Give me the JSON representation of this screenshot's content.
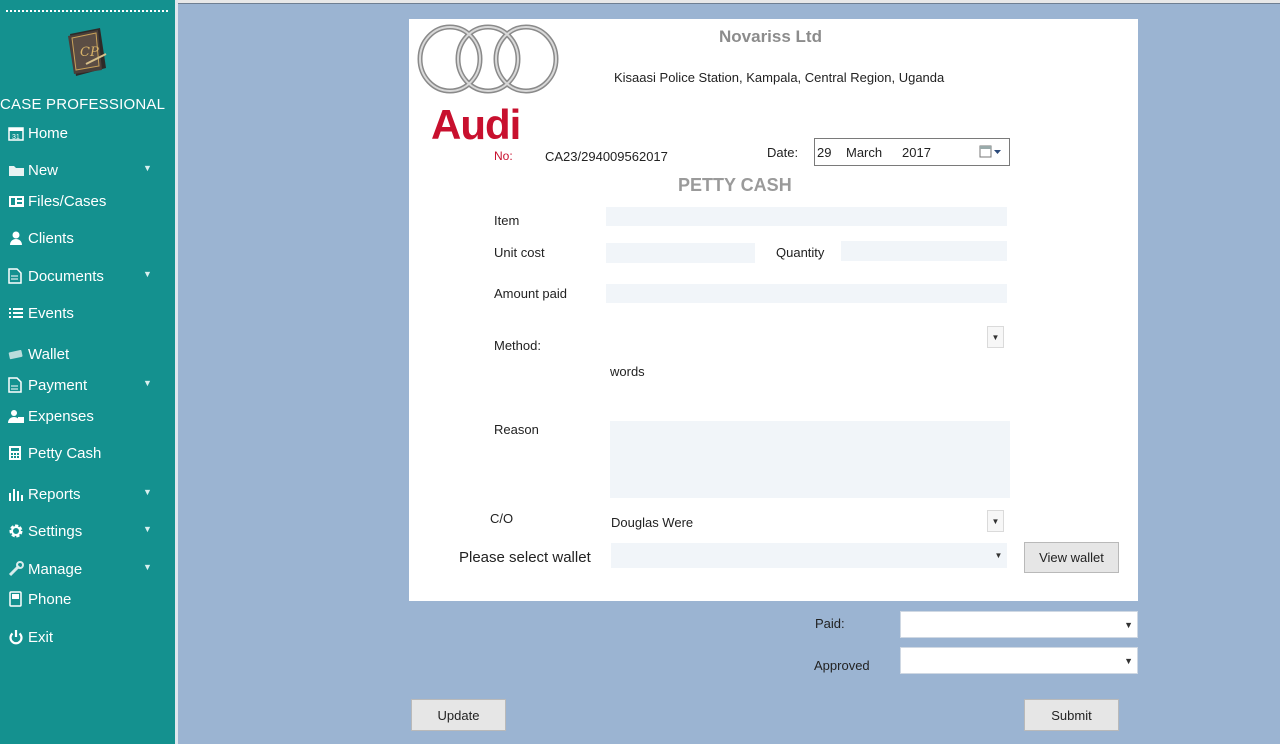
{
  "sidebar": {
    "brand": "CASE PROFESSIONAL",
    "logo_text": "CP",
    "items": [
      {
        "label": "Home",
        "icon": "calendar-icon"
      },
      {
        "label": "New",
        "icon": "folder-icon"
      },
      {
        "label": "Files/Cases",
        "icon": "files-icon"
      },
      {
        "label": "Clients",
        "icon": "clients-icon"
      },
      {
        "label": "Documents",
        "icon": "document-icon"
      },
      {
        "label": "Events",
        "icon": "list-icon"
      },
      {
        "label": "Wallet",
        "icon": "wallet-icon"
      },
      {
        "label": "Payment",
        "icon": "payment-icon"
      },
      {
        "label": "Expenses",
        "icon": "expenses-icon"
      },
      {
        "label": "Petty Cash",
        "icon": "calculator-icon"
      },
      {
        "label": "Reports",
        "icon": "bar-chart-icon"
      },
      {
        "label": "Settings",
        "icon": "gear-icon"
      },
      {
        "label": "Manage",
        "icon": "wrench-icon"
      },
      {
        "label": "Phone",
        "icon": "phone-icon"
      },
      {
        "label": "Exit",
        "icon": "power-icon"
      }
    ]
  },
  "header": {
    "company": "Novariss Ltd",
    "address": "Kisaasi  Police Station, Kampala, Central Region, Uganda",
    "logo_word": "Audi"
  },
  "form": {
    "no_label": "No:",
    "no_value": "CA23/294009562017",
    "date_label": "Date:",
    "date_day": "29",
    "date_month": "March",
    "date_year": "2017",
    "title": "PETTY CASH",
    "item_label": "Item",
    "item_value": "",
    "unit_cost_label": "Unit cost",
    "unit_cost_value": "",
    "quantity_label": "Quantity",
    "quantity_value": "",
    "amount_paid_label": "Amount paid",
    "amount_paid_value": "",
    "method_label": "Method:",
    "method_value": "",
    "words_label": "words",
    "reason_label": "Reason",
    "reason_value": "",
    "co_label": "C/O",
    "co_value": "Douglas Were",
    "wallet_label": "Please select wallet",
    "wallet_value": "",
    "view_wallet_button": "View wallet"
  },
  "footer": {
    "paid_label": "Paid:",
    "paid_value": "",
    "approved_label": "Approved",
    "approved_value": "",
    "update_button": "Update",
    "submit_button": "Submit"
  },
  "colors": {
    "sidebar_bg": "#14918f",
    "page_bg": "#9bb4d2",
    "panel_bg": "#ffffff",
    "audi_red": "#c8102e",
    "no_label_red": "#c8102e",
    "field_bg": "#f1f5f9"
  }
}
